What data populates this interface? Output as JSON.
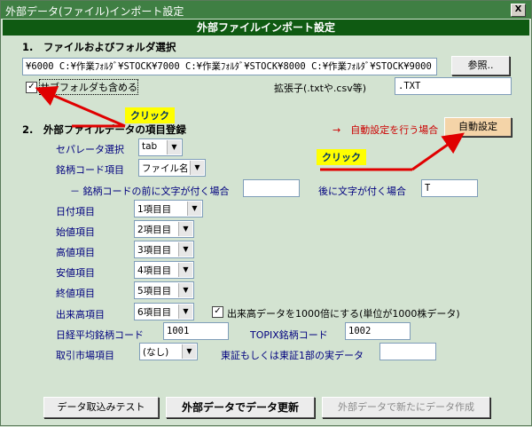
{
  "window": {
    "title": "外部データ(ファイル)インポート設定",
    "close": "X"
  },
  "banner": "外部ファイルインポート設定",
  "section1": {
    "title": "1.　ファイルおよびフォルダ選択",
    "path": "¥6000 C:¥作業ﾌｫﾙﾀﾞ¥STOCK¥7000 C:¥作業ﾌｫﾙﾀﾞ¥STOCK¥8000 C:¥作業ﾌｫﾙﾀﾞ¥STOCK¥9000",
    "browse_label": "参照..",
    "subfolder_label": "サブフォルダも含める",
    "subfolder_checked": "✓",
    "ext_label": "拡張子(.txtや.csv等)",
    "ext_value": ".TXT"
  },
  "section2": {
    "title": "2.　外部ファイルデータの項目登録",
    "auto_hint": "→　自動設定を行う場合",
    "auto_button": "自動設定",
    "separator_label": "セパレータ選択",
    "separator_value": "tab",
    "code_item_label": "銘柄コード項目",
    "code_item_value": "ファイル名",
    "prefix_label": "－ 銘柄コードの前に文字が付く場合",
    "prefix_value": "",
    "suffix_label": "後に文字が付く場合",
    "suffix_value": "T",
    "rows": [
      {
        "label": "日付項目",
        "value": "1項目目"
      },
      {
        "label": "始値項目",
        "value": "2項目目"
      },
      {
        "label": "高値項目",
        "value": "3項目目"
      },
      {
        "label": "安値項目",
        "value": "4項目目"
      },
      {
        "label": "終値項目",
        "value": "5項目目"
      },
      {
        "label": "出来高項目",
        "value": "6項目目"
      }
    ],
    "volume_checkbox_label": "出来高データを1000倍にする(単位が1000株データ)",
    "volume_checked": "✓",
    "nikkei_label": "日経平均銘柄コード",
    "nikkei_value": "1001",
    "topix_label": "TOPIX銘柄コード",
    "topix_value": "1002",
    "market_label": "取引市場項目",
    "market_value": "(なし)",
    "tse_label": "東証もしくは東証1部の実データ",
    "tse_value": ""
  },
  "buttons": {
    "test": "データ取込みテスト",
    "update": "外部データでデータ更新",
    "create": "外部データで新たにデータ作成"
  },
  "annotations": {
    "click1": "クリック",
    "click2": "クリック"
  }
}
